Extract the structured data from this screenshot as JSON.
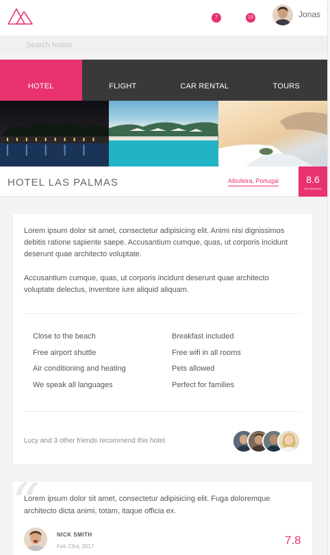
{
  "header": {
    "user_name": "Jonas",
    "notifications": [
      {
        "icon": "bell-icon",
        "count": "7"
      },
      {
        "icon": "bell-icon",
        "count": "13"
      }
    ]
  },
  "search": {
    "placeholder": "Search hotels"
  },
  "tabs": [
    {
      "label": "HOTEL",
      "active": true
    },
    {
      "label": "FLIGHT",
      "active": false
    },
    {
      "label": "CAR RENTAL",
      "active": false
    },
    {
      "label": "TOURS",
      "active": false
    }
  ],
  "hotel": {
    "name": "HOTEL LAS PALMAS",
    "location": "Albufeira, Portugal",
    "score": "8.6",
    "score_caption": "ON REVIEWS"
  },
  "details": {
    "paragraph1": "Lorem ipsum dolor sit amet, consectetur adipisicing elit. Animi nisi dignissimos debitis ratione sapiente saepe. Accusantium cumque, quas, ut corporis incidunt deserunt quae architecto voluptate.",
    "paragraph2": "Accusantium cumque, quas, ut corporis incidunt deserunt quae architecto voluptate delectus, inventore iure aliquid aliquam.",
    "features": [
      "Close to the beach",
      "Breakfast included",
      "Free airport shuttle",
      "Free wifi in all rooms",
      "Air conditioning and heating",
      "Pets allowed",
      "We speak all languages",
      "Perfect for families"
    ],
    "recommend_text": "Lucy and 3 other friends recommend this hotel."
  },
  "review": {
    "text": "Lorem ipsum dolor sit amet, consectetur adipisicing elit. Fuga doloremque architecto dicta animi, totam, itaque officia ex.",
    "author": "NICK SMITH",
    "date": "Feb 23rd, 2017",
    "score": "7.8"
  },
  "colors": {
    "accent": "#e8336e",
    "tab_bar": "#393939",
    "background": "#f4f2f3"
  }
}
